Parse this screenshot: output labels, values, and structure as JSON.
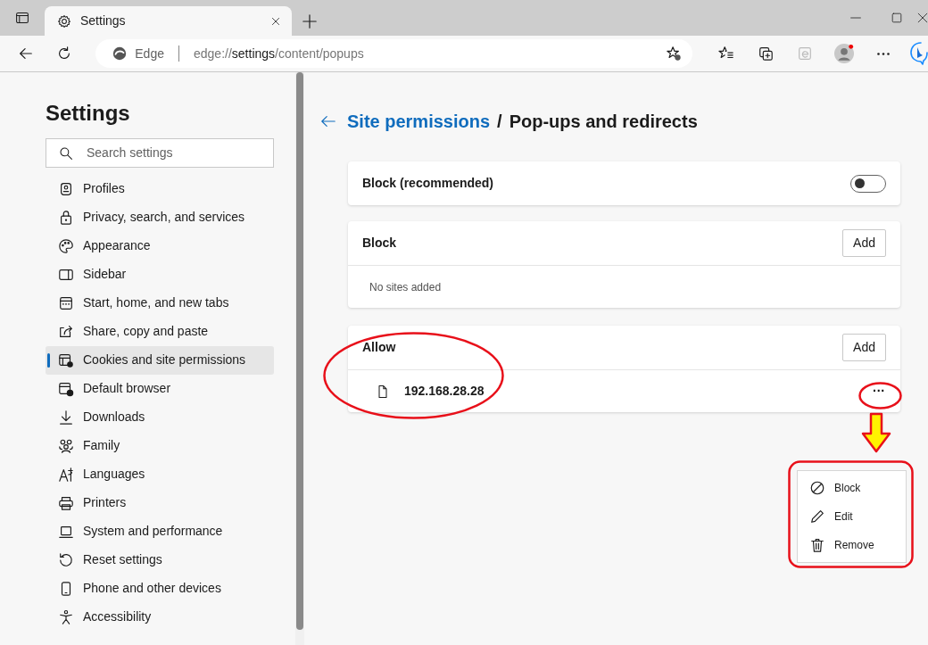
{
  "tab": {
    "title": "Settings",
    "selected": true
  },
  "address_bar": {
    "site_label": "Edge",
    "url_prefix": "edge://",
    "url_host": "settings",
    "url_path": "/content/popups"
  },
  "sidebar": {
    "title": "Settings",
    "search": {
      "placeholder": "Search settings"
    },
    "items": [
      {
        "label": "Profiles",
        "selected": false
      },
      {
        "label": "Privacy, search, and services",
        "selected": false
      },
      {
        "label": "Appearance",
        "selected": false
      },
      {
        "label": "Sidebar",
        "selected": false
      },
      {
        "label": "Start, home, and new tabs",
        "selected": false
      },
      {
        "label": "Share, copy and paste",
        "selected": false
      },
      {
        "label": "Cookies and site permissions",
        "selected": true
      },
      {
        "label": "Default browser",
        "selected": false
      },
      {
        "label": "Downloads",
        "selected": false
      },
      {
        "label": "Family",
        "selected": false
      },
      {
        "label": "Languages",
        "selected": false
      },
      {
        "label": "Printers",
        "selected": false
      },
      {
        "label": "System and performance",
        "selected": false
      },
      {
        "label": "Reset settings",
        "selected": false
      },
      {
        "label": "Phone and other devices",
        "selected": false
      },
      {
        "label": "Accessibility",
        "selected": false
      }
    ]
  },
  "breadcrumb": {
    "parent": "Site permissions",
    "separator": "/",
    "current": "Pop-ups and redirects"
  },
  "cards": [
    {
      "kind": "toggle",
      "title": "Block (recommended)",
      "on": false
    },
    {
      "kind": "list",
      "title": "Block",
      "button": "Add",
      "empty_text": "No sites added"
    },
    {
      "kind": "list",
      "title": "Allow",
      "button": "Add",
      "sites": [
        {
          "address": "192.168.28.28",
          "more": "···"
        }
      ]
    }
  ],
  "context_menu": {
    "items": [
      {
        "label": "Block"
      },
      {
        "label": "Edit"
      },
      {
        "label": "Remove"
      }
    ]
  },
  "annotations": [
    {
      "kind": "ellipse"
    },
    {
      "kind": "ellipse"
    },
    {
      "kind": "arrow"
    },
    {
      "kind": "frame"
    }
  ]
}
